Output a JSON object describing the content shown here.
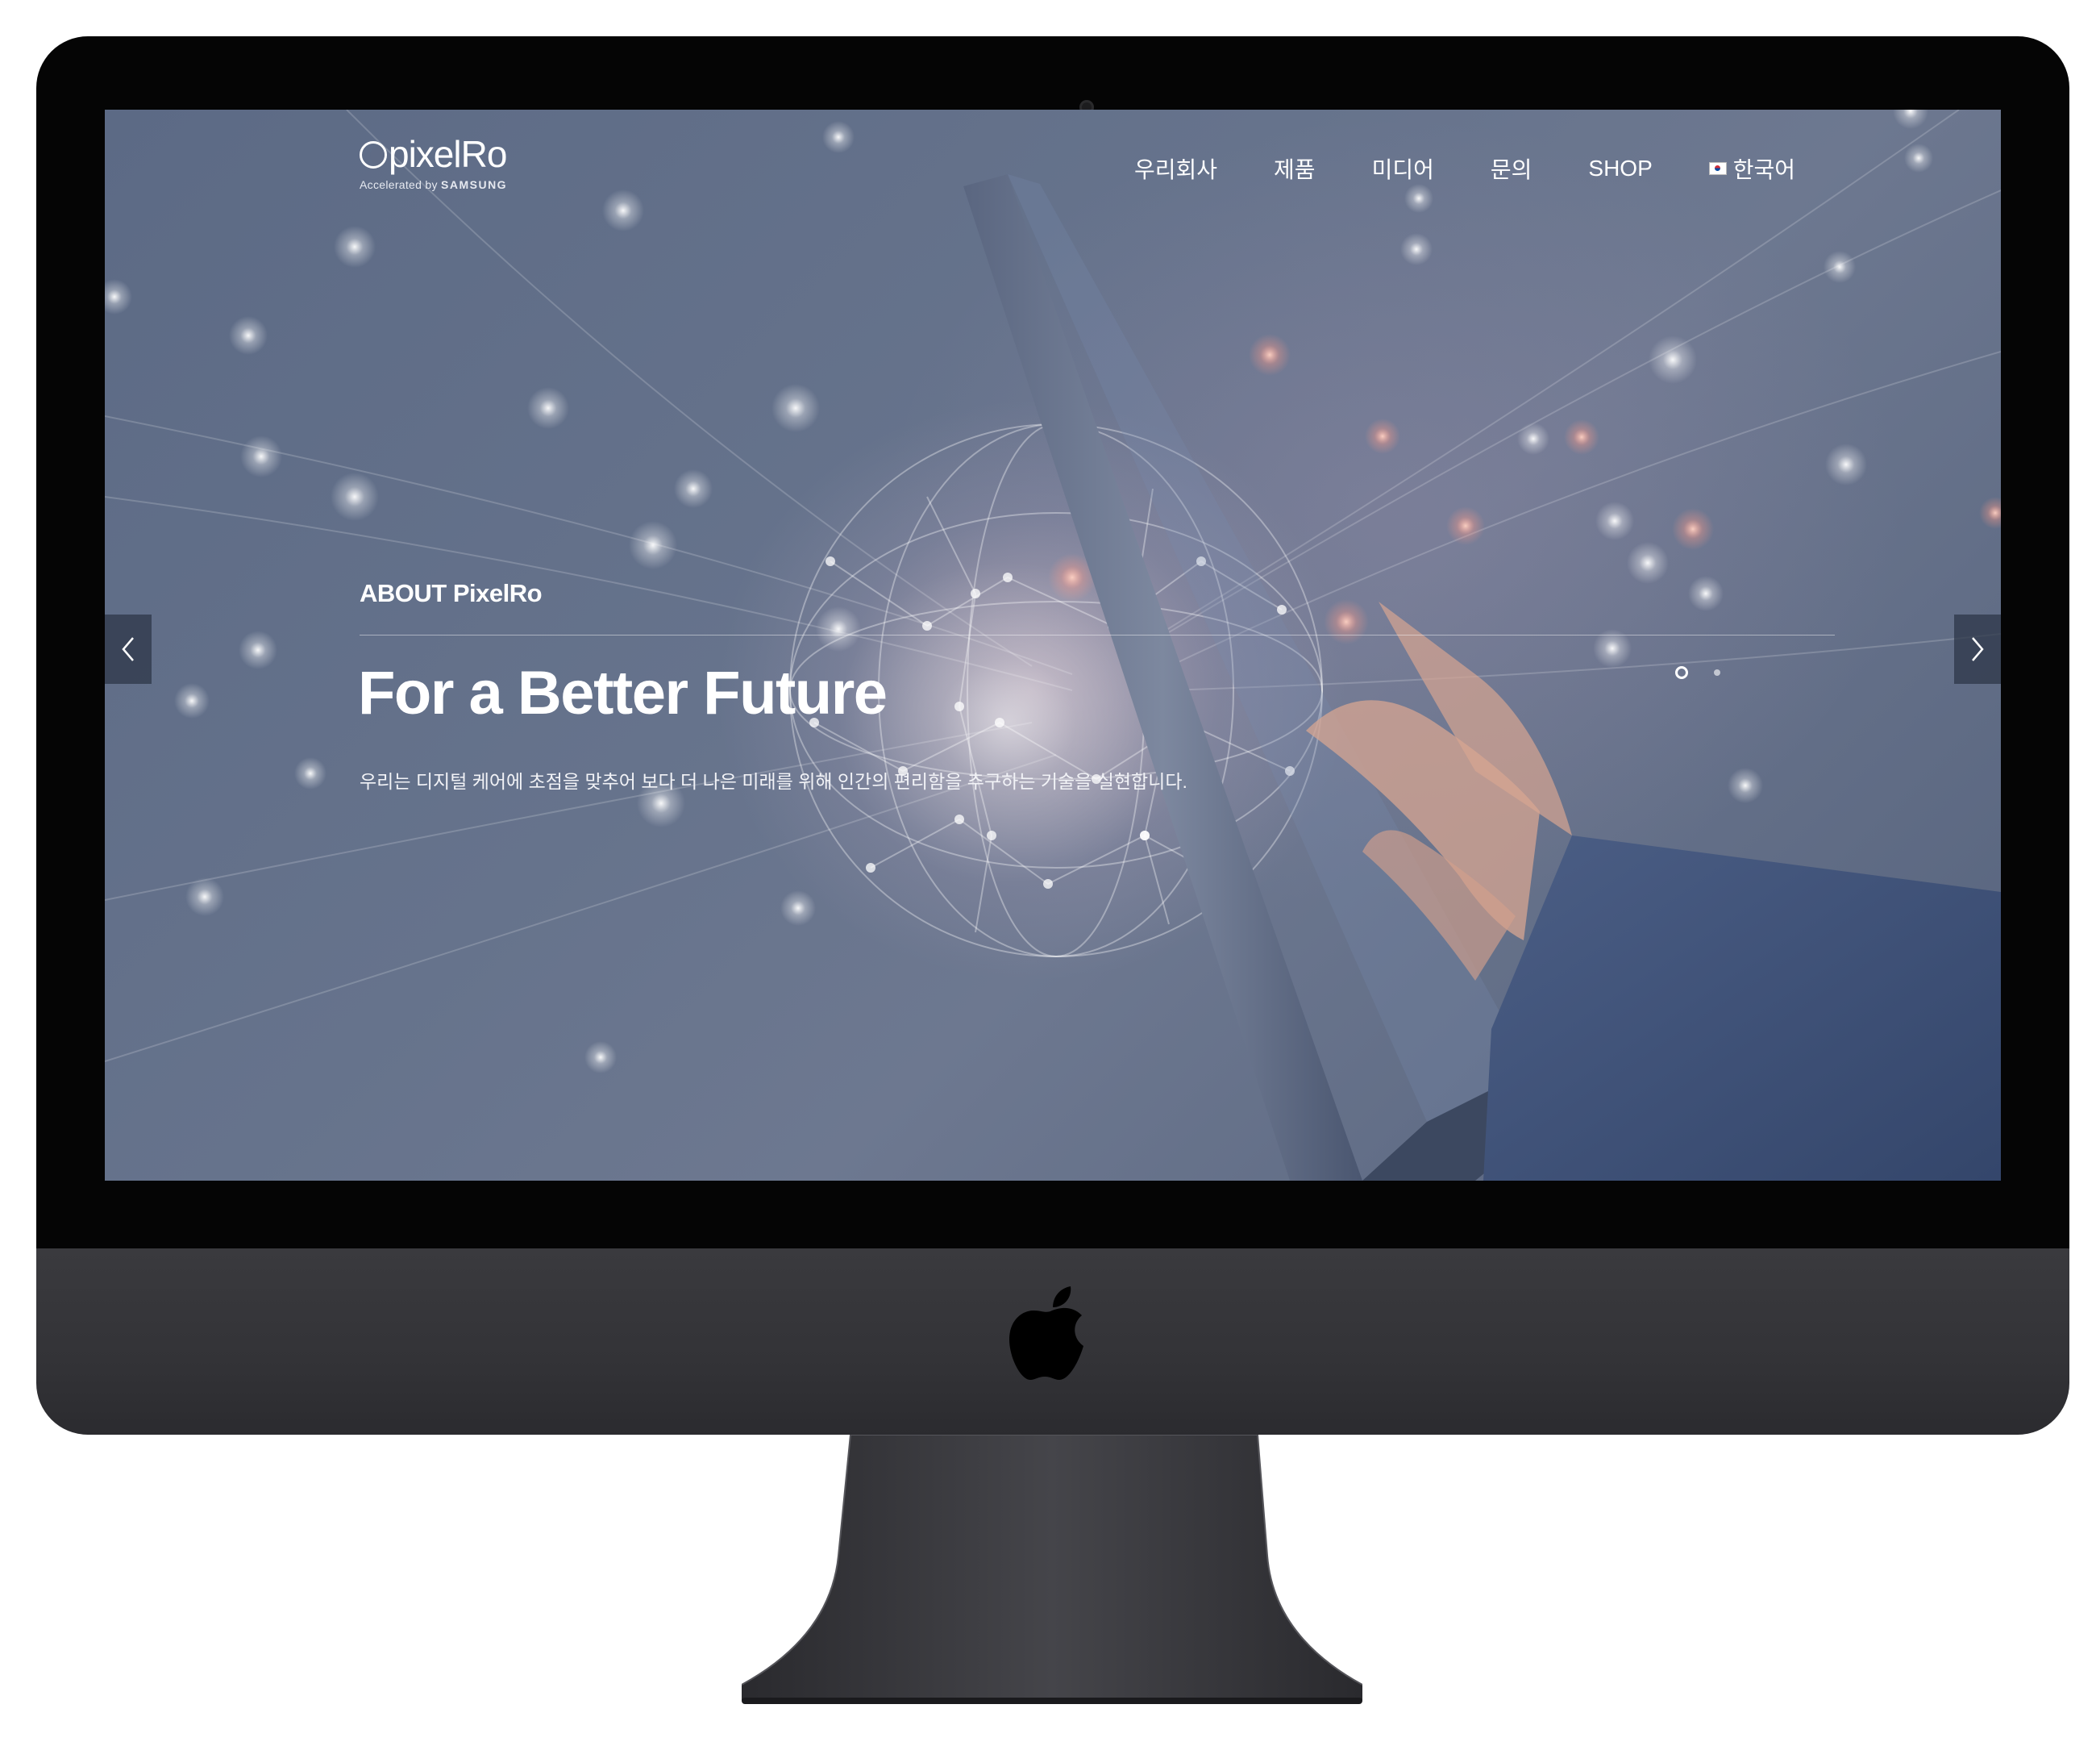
{
  "header": {
    "logo_text": "pixelRo",
    "logo_tagline_prefix": "Accelerated by",
    "logo_tagline_brand": "SAMSUNG"
  },
  "nav": {
    "items": [
      "우리회사",
      "제품",
      "미디어",
      "문의",
      "SHOP"
    ],
    "language": "한국어"
  },
  "hero": {
    "subtitle": "ABOUT PixelRo",
    "headline": "For a Better Future",
    "description": "우리는 디지털 케어에 초점을 맞추어 보다 더 나은 미래를 위해 인간의 편리함을 추구하는 기술을 실현합니다."
  },
  "slider": {
    "total_slides": 2,
    "active_slide": 1
  },
  "icons": {
    "prev": "chevron-left-icon",
    "next": "chevron-right-icon",
    "language_flag": "korea-flag-icon",
    "device_logo": "apple-logo-icon"
  },
  "colors": {
    "hero_background": "#5f6b85",
    "text": "#ffffff",
    "device_body": "#333337"
  }
}
